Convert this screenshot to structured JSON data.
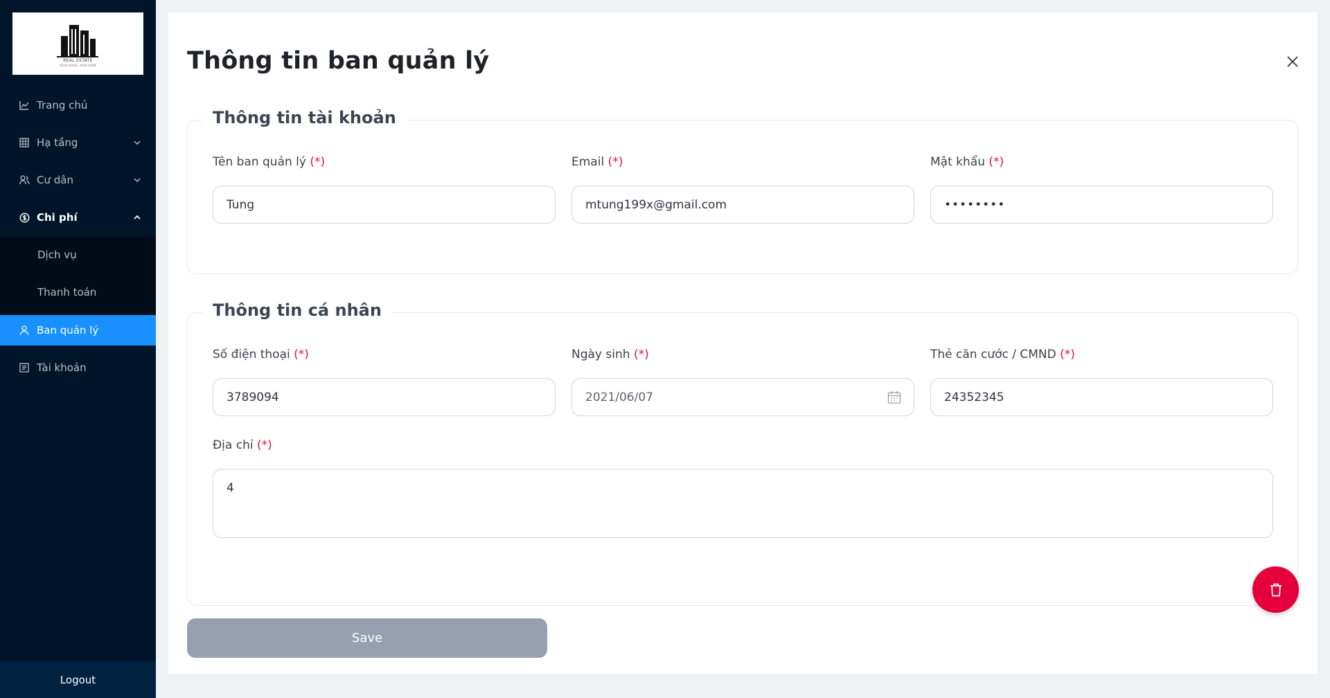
{
  "sidebar": {
    "logo": {
      "caption": "REAL ESTATE",
      "sub": "YOUR HOUSE, YOUR HOME",
      "icon": "building-logo"
    },
    "items": [
      {
        "label": "Trang chủ",
        "icon": "chart-icon"
      },
      {
        "label": "Hạ tầng",
        "icon": "grid-icon",
        "expandable": true
      },
      {
        "label": "Cư dân",
        "icon": "users-icon",
        "expandable": true
      },
      {
        "label": "Chi phí",
        "icon": "cost-icon",
        "expandable": true,
        "open": true
      },
      {
        "label": "Dịch vụ",
        "sub": true
      },
      {
        "label": "Thanh toán",
        "sub": true
      },
      {
        "label": "Ban quản lý",
        "icon": "user-icon",
        "active": true
      },
      {
        "label": "Tài khoản",
        "icon": "profile-icon"
      }
    ],
    "logout": "Logout"
  },
  "panel": {
    "title": "Thông tin ban quản lý",
    "account_section": {
      "legend": "Thông tin tài khoản",
      "name_label": "Tên ban quản lý",
      "name_value": "Tung",
      "email_label": "Email",
      "email_value": "mtung199x@gmail.com",
      "password_label": "Mật khẩu",
      "password_value": "••••••••"
    },
    "personal_section": {
      "legend": "Thông tin cá nhân",
      "phone_label": "Số điện thoại",
      "phone_value": "3789094",
      "dob_label": "Ngày sinh",
      "dob_value": "2021/06/07",
      "id_label": "Thẻ căn cước / CMND",
      "id_value": "24352345",
      "address_label": "Địa chỉ",
      "address_value": "4"
    },
    "required_mark": "(*)",
    "save_label": "Save"
  },
  "colors": {
    "sidebar_bg": "#001529",
    "active_item": "#1890ff",
    "required": "#e0143c",
    "save_disabled": "#979fb1",
    "delete_button": "#e5003c"
  }
}
